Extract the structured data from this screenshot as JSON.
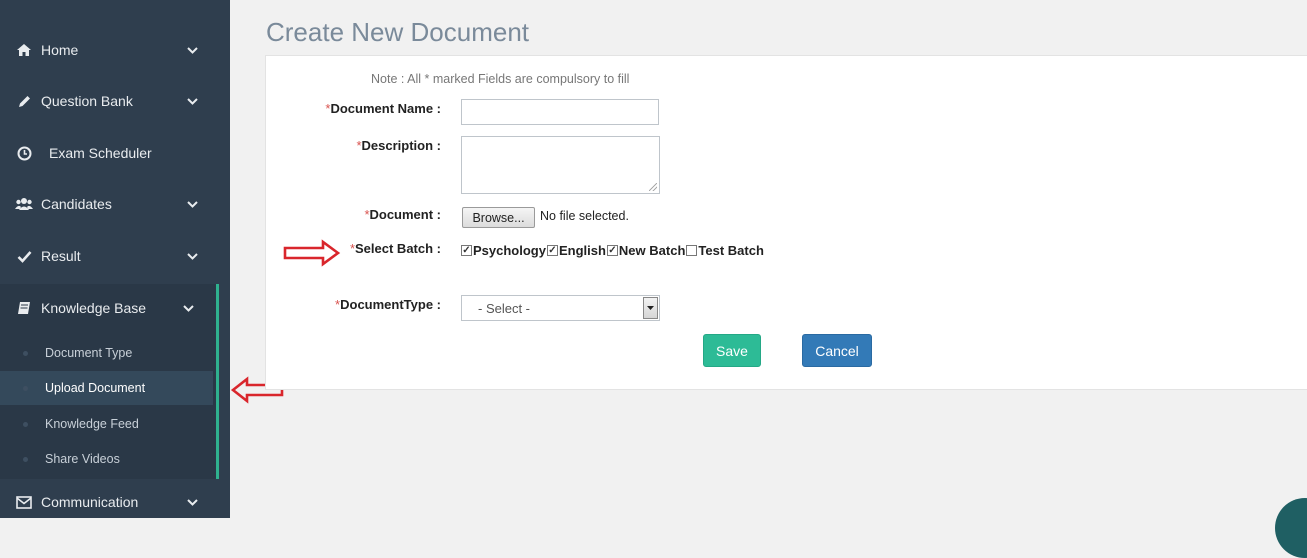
{
  "sidebar": {
    "items": [
      {
        "label": "Home",
        "icon": "home-icon"
      },
      {
        "label": "Question Bank",
        "icon": "pencil-icon"
      },
      {
        "label": "Exam Scheduler",
        "icon": "clock-icon"
      },
      {
        "label": "Candidates",
        "icon": "users-icon"
      },
      {
        "label": "Result",
        "icon": "check-icon"
      },
      {
        "label": "Knowledge Base",
        "icon": "book-icon"
      },
      {
        "label": "Communication",
        "icon": "envelope-icon"
      }
    ],
    "sub_items": [
      {
        "label": "Document Type"
      },
      {
        "label": "Upload Document",
        "active": true
      },
      {
        "label": "Knowledge Feed"
      },
      {
        "label": "Share Videos"
      }
    ],
    "accent_color": "#2fb18f"
  },
  "page": {
    "title": "Create New Document",
    "note": "Note : All * marked Fields are compulsory to fill"
  },
  "form": {
    "required_marker": "*",
    "document_name_label": "Document Name :",
    "document_name_value": "",
    "description_label": "Description :",
    "description_value": "",
    "document_label": "Document :",
    "browse_label": "Browse...",
    "no_file_text": "No file selected.",
    "select_batch_label": "Select Batch :",
    "batches": [
      {
        "label": "Psychology",
        "checked": true
      },
      {
        "label": "English",
        "checked": true
      },
      {
        "label": "New Batch",
        "checked": true
      },
      {
        "label": "Test Batch",
        "checked": false
      }
    ],
    "document_type_label": "DocumentType :",
    "document_type_selected": "- Select -",
    "save_label": "Save",
    "cancel_label": "Cancel"
  },
  "colors": {
    "save": "#2dbb96",
    "cancel": "#337ab7",
    "annotation_arrow": "#d9262c"
  }
}
